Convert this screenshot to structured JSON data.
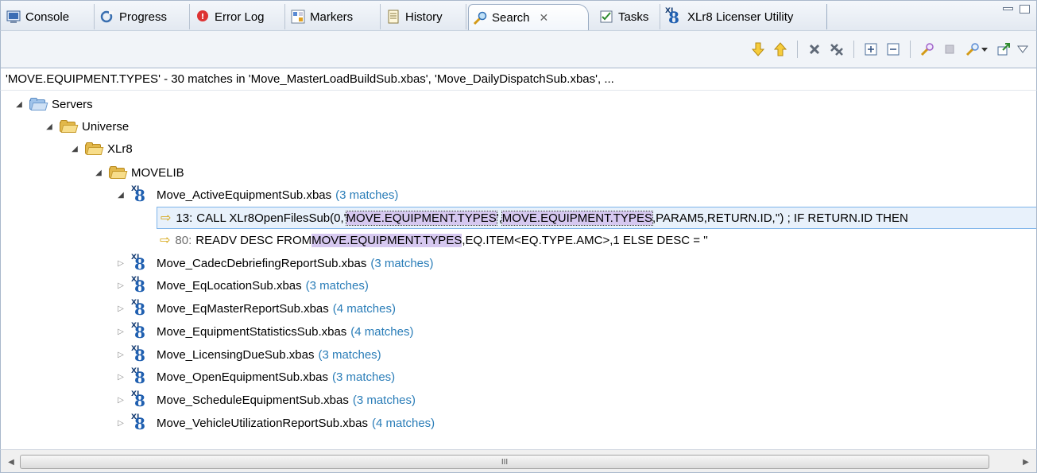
{
  "tabs": [
    {
      "label": "Console",
      "icon": "console-icon"
    },
    {
      "label": "Progress",
      "icon": "progress-icon"
    },
    {
      "label": "Error Log",
      "icon": "error-log-icon"
    },
    {
      "label": "Markers",
      "icon": "markers-icon"
    },
    {
      "label": "History",
      "icon": "history-icon"
    },
    {
      "label": "Search",
      "icon": "search-icon",
      "active": true,
      "close": "✕"
    },
    {
      "label": "Tasks",
      "icon": "tasks-icon"
    },
    {
      "label": "XLr8 Licenser Utility",
      "icon": "xlr8-icon"
    }
  ],
  "xlr8_logo": {
    "small": "XL",
    "big": "8"
  },
  "summary": "'MOVE.EQUIPMENT.TYPES' - 30 matches in 'Move_MasterLoadBuildSub.xbas', 'Move_DailyDispatchSub.xbas', ...",
  "tree": {
    "servers": "Servers",
    "universe": "Universe",
    "xlr8": "XLr8",
    "movelib": "MOVELIB",
    "expanded_file": {
      "name": "Move_ActiveEquipmentSub.xbas",
      "matches": "(3 matches)"
    },
    "match_lines": [
      {
        "line": "13:",
        "before": "CALL XLr8OpenFilesSub(0,'",
        "hl1": "MOVE.EQUIPMENT.TYPES",
        "mid": "',",
        "hl2": "MOVE.EQUIPMENT.TYPES",
        "after": ",PARAM5,RETURN.ID,'') ; IF RETURN.ID THEN"
      },
      {
        "line": "80:",
        "before": "READV DESC FROM ",
        "hl1": "MOVE.EQUIPMENT.TYPES",
        "after": ",EQ.ITEM<EQ.TYPE.AMC>,1 ELSE DESC = ''"
      }
    ],
    "files": [
      {
        "name": "Move_CadecDebriefingReportSub.xbas",
        "matches": "(3 matches)"
      },
      {
        "name": "Move_EqLocationSub.xbas",
        "matches": "(3 matches)"
      },
      {
        "name": "Move_EqMasterReportSub.xbas",
        "matches": "(4 matches)"
      },
      {
        "name": "Move_EquipmentStatisticsSub.xbas",
        "matches": "(4 matches)"
      },
      {
        "name": "Move_LicensingDueSub.xbas",
        "matches": "(3 matches)"
      },
      {
        "name": "Move_OpenEquipmentSub.xbas",
        "matches": "(3 matches)"
      },
      {
        "name": "Move_ScheduleEquipmentSub.xbas",
        "matches": "(3 matches)"
      },
      {
        "name": "Move_VehicleUtilizationReportSub.xbas",
        "matches": "(4 matches)"
      }
    ]
  },
  "scrollbar": {
    "grip": "III"
  },
  "colors": {
    "match_count": "#2a7db8",
    "highlight": "#d6c8f0",
    "selection": "#e8f1fb"
  }
}
